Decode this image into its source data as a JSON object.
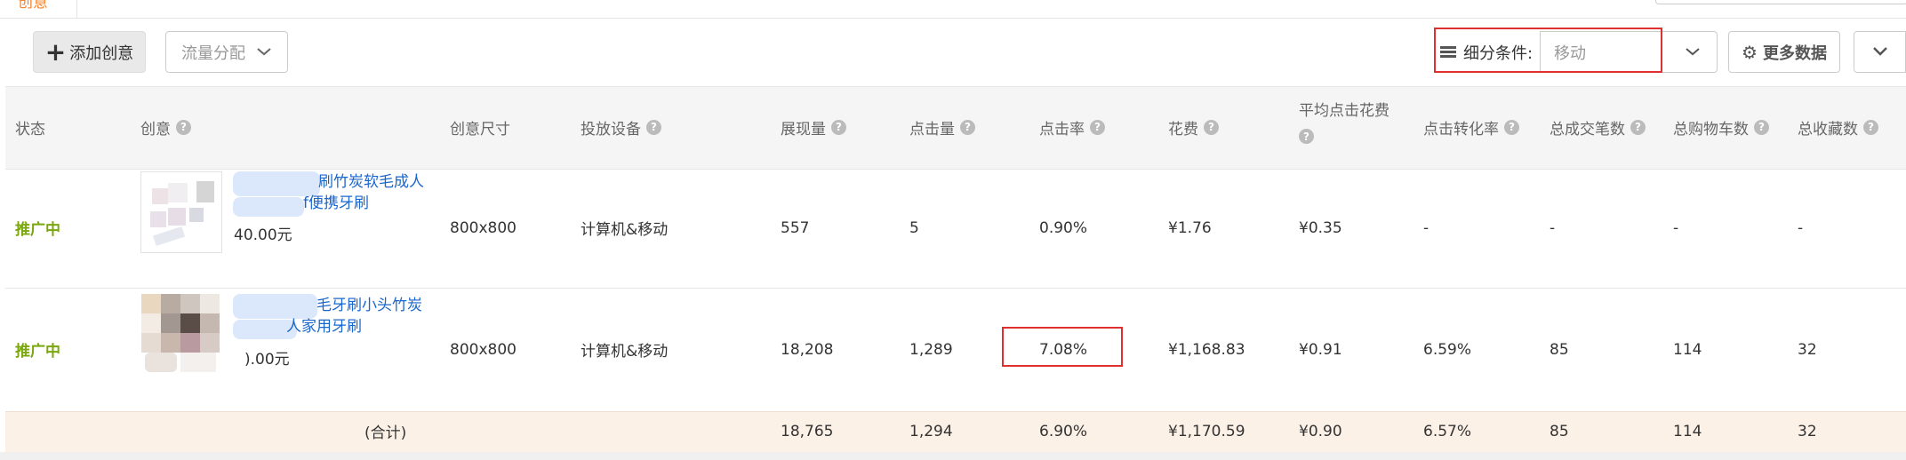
{
  "tabs": {
    "active_label": "创意"
  },
  "toolbar": {
    "add_label": "添加创意",
    "traffic_label": "流量分配",
    "segment_label": "细分条件:",
    "segment_value": "移动",
    "more_data_label": "更多数据"
  },
  "table": {
    "headers": {
      "status": "状态",
      "creative": "创意",
      "size": "创意尺寸",
      "device": "投放设备",
      "impressions": "展现量",
      "clicks": "点击量",
      "ctr": "点击率",
      "cost": "花费",
      "avg_cpc": "平均点击花费",
      "cvr": "点击转化率",
      "orders": "总成交笔数",
      "carts": "总购物车数",
      "favorites": "总收藏数"
    },
    "rows": [
      {
        "status": "推广中",
        "title_line1": "刷竹炭软毛成人",
        "title_line2": "f便携牙刷",
        "price": "40.00元",
        "size": "800x800",
        "device": "计算机&移动",
        "impressions": "557",
        "clicks": "5",
        "ctr": "0.90%",
        "cost": "¥1.76",
        "avg_cpc": "¥0.35",
        "cvr": "-",
        "orders": "-",
        "carts": "-",
        "favorites": "-"
      },
      {
        "status": "推广中",
        "title_line1": "毛牙刷小头竹炭",
        "title_line2": "人家用牙刷",
        "price": ").00元",
        "size": "800x800",
        "device": "计算机&移动",
        "impressions": "18,208",
        "clicks": "1,289",
        "ctr": "7.08%",
        "cost": "¥1,168.83",
        "avg_cpc": "¥0.91",
        "cvr": "6.59%",
        "orders": "85",
        "carts": "114",
        "favorites": "32"
      }
    ],
    "total": {
      "label": "(合计)",
      "impressions": "18,765",
      "clicks": "1,294",
      "ctr": "6.90%",
      "cost": "¥1,170.59",
      "avg_cpc": "¥0.90",
      "cvr": "6.57%",
      "orders": "85",
      "carts": "114",
      "favorites": "32"
    }
  },
  "colors": {
    "accent_tab": "#f5822a",
    "status_green": "#7aa70f",
    "link_blue": "#1a66cc",
    "highlight_red": "#e02f2f",
    "total_bg": "#fcf1e7"
  }
}
